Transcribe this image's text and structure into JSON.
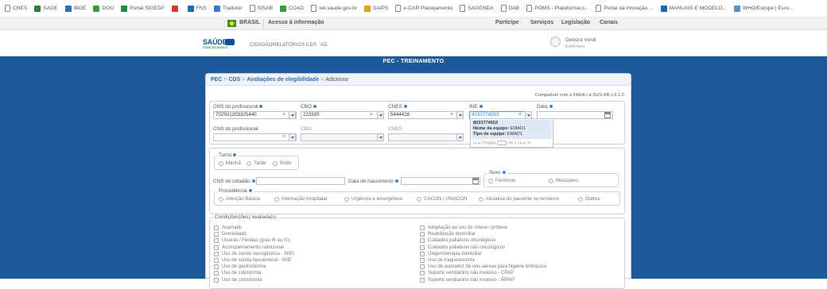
{
  "bookmarks": [
    {
      "label": "CNES",
      "icon": "page-icon",
      "color": "#ffffff"
    },
    {
      "label": "SAGE",
      "icon": "chart-icon",
      "color": "#2f7f3b"
    },
    {
      "label": "IBGE",
      "icon": "ibge-icon",
      "color": "#2c6fb7"
    },
    {
      "label": "DOU",
      "icon": "dou-icon",
      "color": "#3b9a3f"
    },
    {
      "label": "Portal SIGESP",
      "icon": "sigesp-icon",
      "color": "#1f8a3a"
    },
    {
      "label": "",
      "icon": "red-icon",
      "color": "#d23a2a"
    },
    {
      "label": "FNS",
      "icon": "fns-icon",
      "color": "#1c6db5"
    },
    {
      "label": "Tradutor",
      "icon": "translate-icon",
      "color": "#3a79d3"
    },
    {
      "label": "SISAB",
      "icon": "page-icon",
      "color": "#ffffff"
    },
    {
      "label": "COAD",
      "icon": "coad-icon",
      "color": "#3a9a3a"
    },
    {
      "label": "sei.saude.gov.br",
      "icon": "page-icon",
      "color": "#ffffff"
    },
    {
      "label": "SAIPS",
      "icon": "saips-icon",
      "color": "#e0a21c"
    },
    {
      "label": "e-CAR Planejamento",
      "icon": "page-icon",
      "color": "#ffffff"
    },
    {
      "label": "SAGENDA",
      "icon": "page-icon",
      "color": "#ffffff"
    },
    {
      "label": "DAB",
      "icon": "page-icon",
      "color": "#ffffff"
    },
    {
      "label": "POMS - Plataforma o...",
      "icon": "page-icon",
      "color": "#ffffff"
    },
    {
      "label": "Portal da Inovação ...",
      "icon": "page-icon",
      "color": "#ffffff"
    },
    {
      "label": "MANUAIS E MODELO...",
      "icon": "manuais-icon",
      "color": "#1c63b8"
    },
    {
      "label": "WHO/Europe | Euro...",
      "icon": "who-icon",
      "color": "#5b8fc7"
    }
  ],
  "govbar": {
    "brasil": "BRASIL",
    "acesso": "Acesso à informação",
    "links": [
      "Participe",
      "Serviços",
      "Legislação",
      "Canais"
    ]
  },
  "header": {
    "logo_text": "SAÚDE",
    "logo_sub": "ATENÇÃO BÁSICA",
    "menu": [
      "CIDADÃO",
      "RELATÓRIOS",
      "CDS",
      "AD"
    ],
    "user_name": "Debora Verdi",
    "user_role": "Enfermeiro"
  },
  "banner": "PEC - TREINAMENTO",
  "breadcrumb": {
    "items": [
      "PEC",
      "CDS",
      "Avaliações de elegibilidade"
    ],
    "current": "Adicionar"
  },
  "compat": "Compatível com a FAEA / e-SUS AB v.2.1.0",
  "prof": {
    "cns_label": "CNS do profissional",
    "cns_value": "702501203325440",
    "cbo_label": "CBO",
    "cbo_value": "223505",
    "cnes_label": "CNES",
    "cnes_value": "5444428",
    "ine_label": "INE",
    "ine_value": "8033774553",
    "data_label": "Data",
    "cns2_label": "CNS do profissional",
    "cbo2_label": "CBO",
    "cnes2_label": "CNES"
  },
  "popup": {
    "code": "8033774553",
    "nome_label": "Nome da equipe:",
    "nome": "EMAD1",
    "tipo_label": "Tipo de equipe:",
    "tipo": "EMAD1",
    "pagina": "Página",
    "de": "de 1"
  },
  "turno": {
    "legend": "Turno",
    "options": [
      "Manhã",
      "Tarde",
      "Noite"
    ]
  },
  "cidadao": {
    "cns_label": "CNS do cidadão",
    "nasc_label": "Data de nascimento",
    "sexo_legend": "Sexo",
    "sexo_options": [
      "Feminino",
      "Masculino"
    ]
  },
  "procedencia": {
    "legend": "Procedência",
    "options": [
      "Atenção Básica",
      "Internação hospitalar",
      "Urgência e emergência",
      "CACON / UNACON",
      "Iniciativa do paciente ou terceiros",
      "Outros"
    ]
  },
  "condicoes": {
    "legend": "Condições(ões) avaliada(s)",
    "left": [
      "Acamado",
      "Domiciliado",
      "Úlceras / Feridas (grau III ou IV)",
      "Acompanhamento nutricional",
      "Uso de sonda nasogástrica - SNG",
      "Uso de sonda nasoenteral - SNE",
      "Uso de gastrostomia",
      "Uso de colostomia",
      "Uso de cistostomia"
    ],
    "right": [
      "Adaptação ao uso de órtese / prótese",
      "Reabilitação domiciliar",
      "Cuidados paliativos oncológicos",
      "Cuidados paliativos não oncológicos",
      "Oxigenoterapia domiciliar",
      "Uso de traqueostomia",
      "Uso de aspirador de vias aéreas para higiene brônquica",
      "Suporte ventilatório não invasivo - CPAP",
      "Suporte ventilatório não invasivo - BiPAP"
    ]
  }
}
